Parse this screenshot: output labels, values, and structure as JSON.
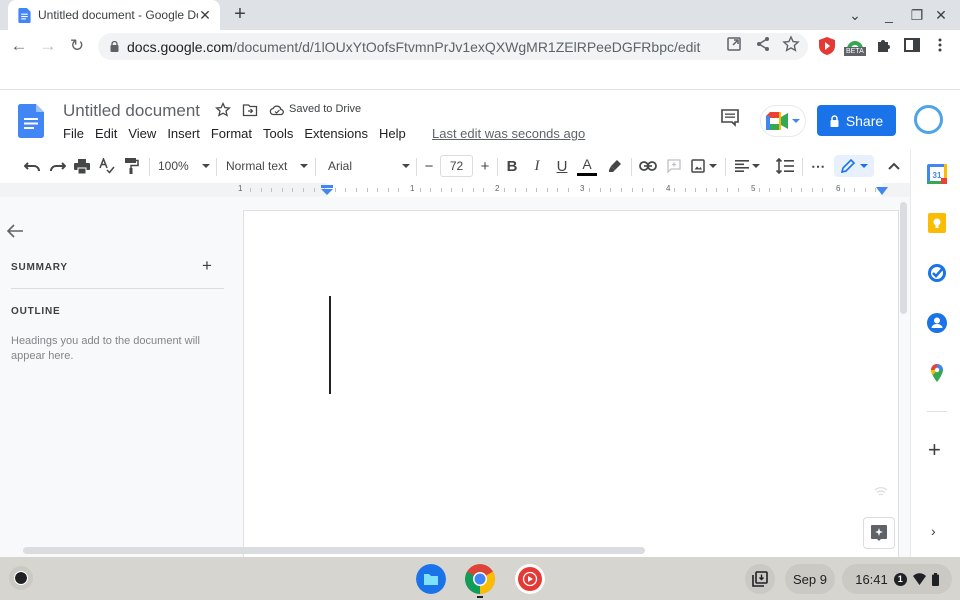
{
  "browser": {
    "tab": {
      "title": "Untitled document - Google Docs",
      "favicon": "google-docs-icon",
      "close_label": "✕"
    },
    "new_tab_label": "+",
    "window_controls": {
      "tab_search": "⌄",
      "minimize": "_",
      "maximize": "❐",
      "close": "✕"
    },
    "nav": {
      "back": "←",
      "forward": "→",
      "reload": "↻"
    },
    "address": {
      "host": "docs.google.com",
      "path": "/document/d/1lOUxYtOofsFtvmnPrJv1exQXWgMR1ZElRPeeDGFRbpc/edit"
    },
    "omnibox_icons": [
      "open-in-app-icon",
      "share-icon",
      "bookmark-star-icon"
    ],
    "extensions": [
      "youtube-shield-extension-icon",
      "beta-extension-icon",
      "extensions-puzzle-icon",
      "side-panel-icon",
      "menu-kebab-icon"
    ],
    "beta_badge": "BETA"
  },
  "docs": {
    "title": "Untitled document",
    "saved_status": "Saved to Drive",
    "menu": [
      "File",
      "Edit",
      "View",
      "Insert",
      "Format",
      "Tools",
      "Extensions",
      "Help"
    ],
    "last_edit": "Last edit was seconds ago",
    "share_label": "Share",
    "toolbar": {
      "zoom": "100%",
      "style": "Normal text",
      "font": "Arial",
      "font_size": "72",
      "decrease": "−",
      "increase": "+",
      "bold": "B",
      "italic": "I",
      "underline": "U",
      "text_color_label": "A",
      "more": "⋯"
    },
    "ruler": {
      "labels": [
        "1",
        "1",
        "2",
        "3",
        "4",
        "5",
        "6"
      ]
    },
    "outline": {
      "summary_label": "SUMMARY",
      "summary_add": "+",
      "outline_label": "OUTLINE",
      "hint": "Headings you add to the document will appear here."
    },
    "side_panel": {
      "apps": [
        "google-calendar-icon",
        "google-keep-icon",
        "google-tasks-icon",
        "google-contacts-icon",
        "google-maps-icon"
      ],
      "add": "+",
      "expand": "›"
    }
  },
  "shelf": {
    "apps": [
      "files-app-icon",
      "chrome-app-icon",
      "youtube-music-app-icon"
    ],
    "date": "Sep 9",
    "time": "16:41",
    "notification_count": "1"
  },
  "colors": {
    "accent": "#1a73e8",
    "docs_blue": "#4285f4"
  }
}
